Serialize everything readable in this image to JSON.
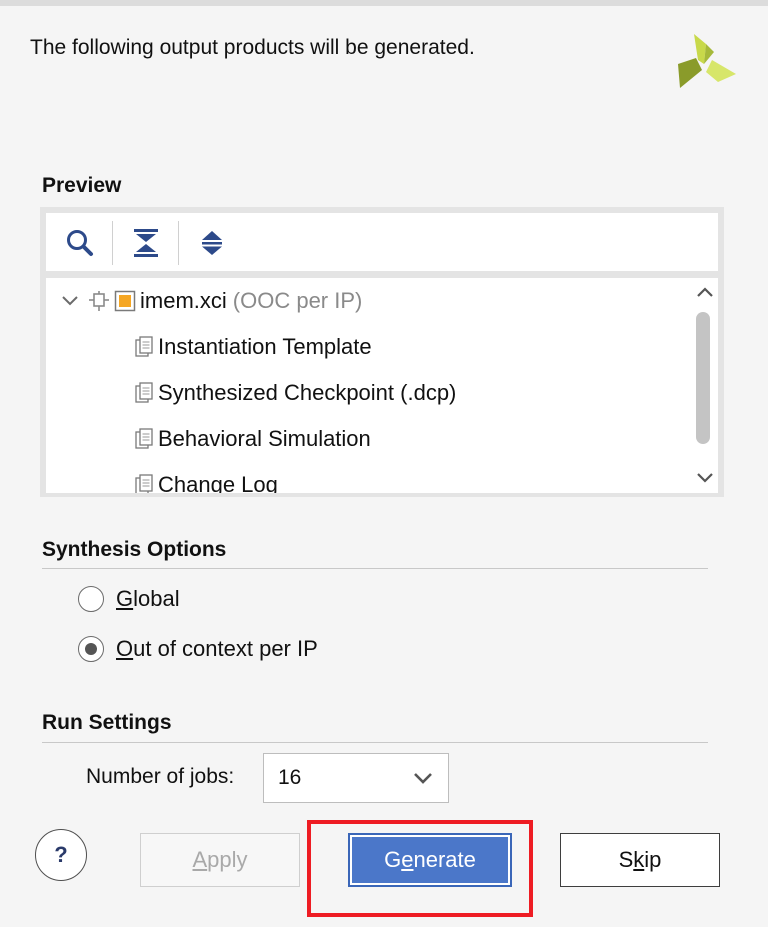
{
  "intro_text": "The following output products will be generated.",
  "preview": {
    "title": "Preview",
    "toolbar": {
      "search_icon": "search-icon",
      "collapse_all_icon": "collapse-all-icon",
      "expand_all_icon": "expand-all-icon"
    },
    "tree": {
      "root": {
        "name": "imem.xci",
        "note": "(OOC per IP)",
        "expanded": true
      },
      "children": [
        "Instantiation Template",
        "Synthesized Checkpoint (.dcp)",
        "Behavioral Simulation",
        "Change Log"
      ]
    }
  },
  "synthesis_options": {
    "title": "Synthesis Options",
    "options": [
      {
        "prefix": "",
        "mnemonic": "G",
        "rest": "lobal",
        "selected": false
      },
      {
        "prefix": "",
        "mnemonic": "O",
        "rest": "ut of context per IP",
        "selected": true
      }
    ]
  },
  "run_settings": {
    "title": "Run Settings",
    "jobs_label_prefix": "Number of ",
    "jobs_label_mnemonic": "j",
    "jobs_label_suffix": "obs:",
    "jobs_value": "16"
  },
  "buttons": {
    "help": "?",
    "apply": {
      "mnemonic": "A",
      "rest": "pply",
      "enabled": false
    },
    "generate": {
      "prefix": "G",
      "mnemonic": "e",
      "rest": "nerate"
    },
    "skip": {
      "prefix": "S",
      "mnemonic": "k",
      "rest": "ip"
    }
  },
  "colors": {
    "accent": "#4b77c9",
    "highlight": "#ee1c23",
    "checkbox_orange": "#f5a623"
  }
}
